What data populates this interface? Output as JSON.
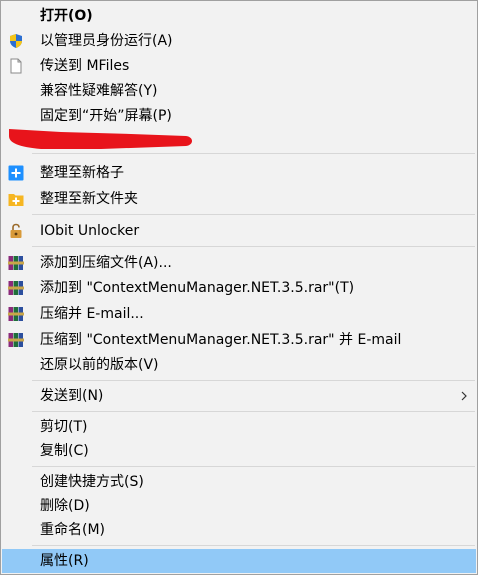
{
  "menu": {
    "open": "打开(O)",
    "run_as_admin": "以管理员身份运行(A)",
    "send_to_mfiles": "传送到 MFiles",
    "troubleshoot_compat": "兼容性疑难解答(Y)",
    "pin_to_start": "固定到“开始”屏幕(P)",
    "organize_new_grid": "整理至新格子",
    "organize_new_folder": "整理至新文件夹",
    "iobit_unlocker": "IObit Unlocker",
    "add_to_archive": "添加到压缩文件(A)...",
    "add_to_rar": "添加到 \"ContextMenuManager.NET.3.5.rar\"(T)",
    "compress_email": "压缩并 E-mail...",
    "compress_to_rar_email": "压缩到 \"ContextMenuManager.NET.3.5.rar\" 并 E-mail",
    "restore_previous": "还原以前的版本(V)",
    "send_to": "发送到(N)",
    "cut": "剪切(T)",
    "copy": "复制(C)",
    "create_shortcut": "创建快捷方式(S)",
    "delete": "删除(D)",
    "rename": "重命名(M)",
    "properties": "属性(R)"
  },
  "icons": {
    "run_as_admin": "uac-shield-icon",
    "send_to_mfiles": "blank-document-icon",
    "organize_new_grid": "blue-plus-icon",
    "organize_new_folder": "folder-plus-icon",
    "iobit_unlocker": "padlock-icon",
    "winrar": "winrar-books-icon",
    "send_to": "chevron-right-icon"
  },
  "colors": {
    "menu_background": "#f2f2f2",
    "selected_highlight": "#91c9f7",
    "annotation_stroke": "#e8141b",
    "border": "#a0a0a0"
  },
  "state": {
    "selected_item": "属性(R)"
  }
}
